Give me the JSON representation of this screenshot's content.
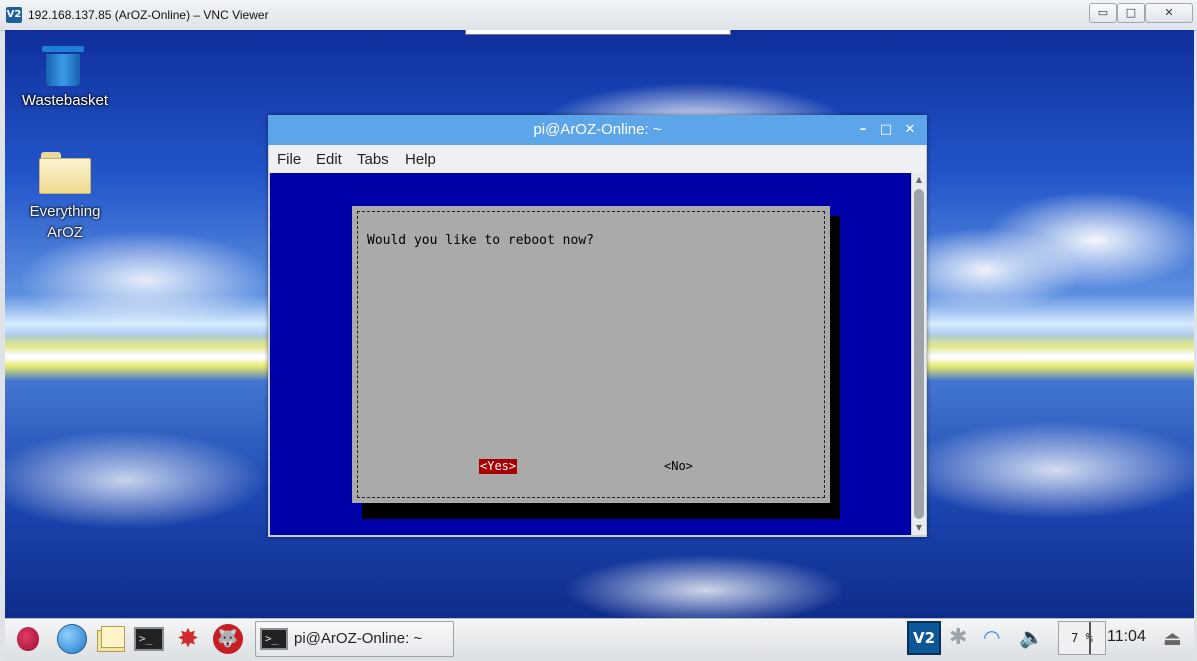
{
  "vnc_window": {
    "title": "192.168.137.85 (ArOZ-Online) – VNC Viewer",
    "logo": "V2",
    "controls": {
      "minimize": "▭",
      "maximize": "□",
      "close": "✕"
    }
  },
  "desktop": {
    "icons": [
      {
        "label": "Wastebasket",
        "icon": "trash-icon"
      },
      {
        "label": "Everything\nArOZ",
        "icon": "folder-icon"
      }
    ]
  },
  "terminal": {
    "title": "pi@ArOZ-Online: ~",
    "controls": {
      "minimize": "–",
      "maximize": "□",
      "close": "✕"
    },
    "menu": [
      "File",
      "Edit",
      "Tabs",
      "Help"
    ],
    "dialog": {
      "message": "Would you like to reboot now?",
      "yes_label": "<Yes>",
      "no_label": "<No>",
      "selected": "yes"
    }
  },
  "taskbar": {
    "task_label": "pi@ArOZ-Online: ~",
    "vnc_label": "V2",
    "cpu_usage": "7 %",
    "clock": "11:04",
    "launchers": [
      "raspberry-menu-icon",
      "web-browser-icon",
      "file-manager-icon",
      "terminal-icon",
      "math-kernel-icon",
      "wolfram-icon"
    ]
  },
  "colors": {
    "terminal_bg": "#0000a8",
    "dialog_bg": "#aaaaaa",
    "selected_button": "#a80000",
    "titlebar_blue": "#5ca5e8"
  }
}
